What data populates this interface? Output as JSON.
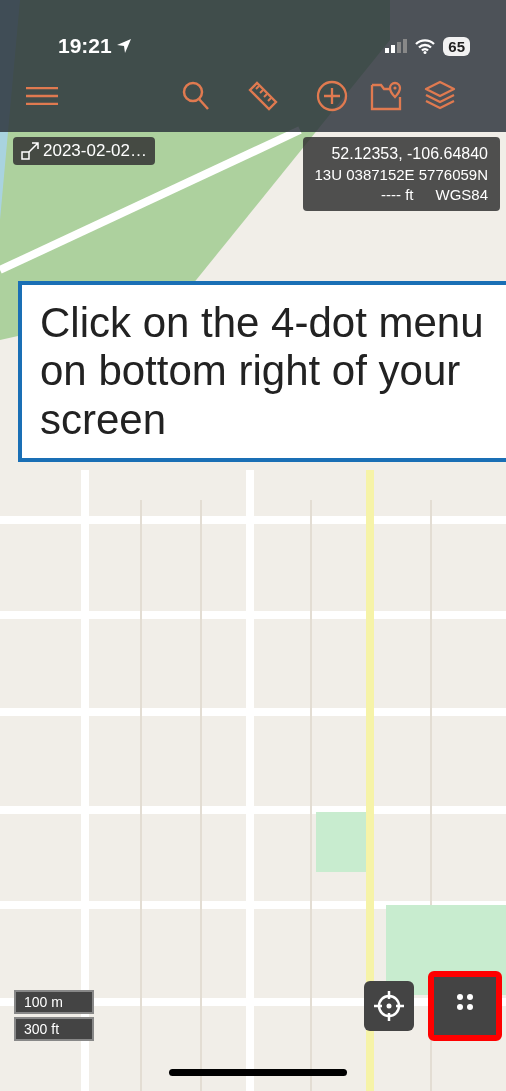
{
  "status_bar": {
    "time": "19:21",
    "battery": "65"
  },
  "track_chip": {
    "label": "2023-02-02…"
  },
  "coordinates": {
    "latlon": "52.12353, -106.64840",
    "utm": "13U 0387152E 5776059N",
    "elevation": "---- ft",
    "datum": "WGS84"
  },
  "callout": {
    "text": "Click on the 4-dot menu on bottom right of your screen"
  },
  "scale": [
    "100 m",
    "300 ft"
  ],
  "map_controls": [
    {
      "kind": "locate",
      "highlighted": false
    },
    {
      "kind": "menu",
      "highlighted": true
    }
  ]
}
